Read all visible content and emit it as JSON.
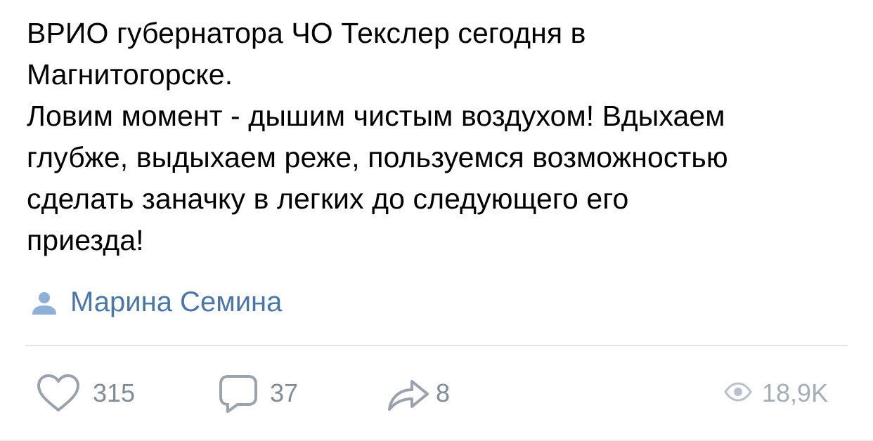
{
  "post": {
    "text": "ВРИО губернатора ЧО Текслер сегодня в\nМагнитогорске.\nЛовим момент - дышим чистым воздухом! Вдыхаем\nглубже, выдыхаем реже, пользуемся возможностью\nсделать заначку в легких до следующего его\nприезда!",
    "author": {
      "name": "Марина Семина",
      "icon": "user-icon"
    }
  },
  "actions": {
    "likes": {
      "icon": "heart-icon",
      "count": "315"
    },
    "comments": {
      "icon": "comment-icon",
      "count": "37"
    },
    "shares": {
      "icon": "share-icon",
      "count": "8"
    },
    "views": {
      "icon": "eye-icon",
      "count": "18,9K"
    }
  },
  "colors": {
    "text": "#000000",
    "link": "#4a76a8",
    "icon": "#99a2ad",
    "muted": "#818c99",
    "divider": "#e3e4e8"
  }
}
